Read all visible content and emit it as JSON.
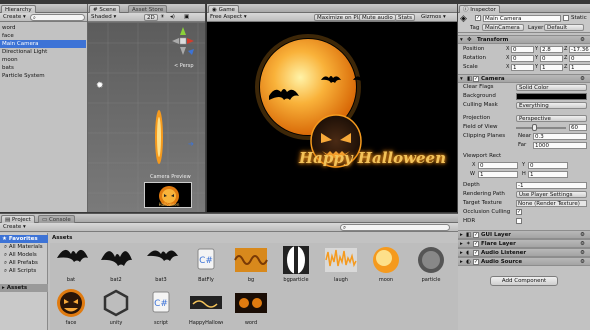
{
  "hierarchy": {
    "tab": "Hierarchy",
    "create": "Create",
    "search_icon": "search-icon",
    "items": [
      "word",
      "face",
      "Main Camera",
      "Directional Light",
      "moon",
      "bats",
      "Particle System"
    ],
    "selected_index": 2
  },
  "scene": {
    "tab": "Scene",
    "mode": "Shaded",
    "toggle_2d": "2D",
    "gizmo_label": "< Persp",
    "camera_preview": "Camera Preview"
  },
  "asset_store": {
    "tab": "Asset Store"
  },
  "game": {
    "tab": "Game",
    "aspect": "Free Aspect",
    "maximize": "Maximize on Play",
    "mute": "Mute audio",
    "stats": "Stats",
    "gizmos": "Gizmos",
    "title": "Happy Halloween"
  },
  "inspector": {
    "tab": "Inspector",
    "object_name": "Main Camera",
    "static": "Static",
    "tag_label": "Tag",
    "tag_value": "MainCamera",
    "layer_label": "Layer",
    "layer_value": "Default",
    "transform": {
      "title": "Transform",
      "rows": [
        {
          "label": "Position",
          "x": "0",
          "y": "2.8",
          "z": "-17.36"
        },
        {
          "label": "Rotation",
          "x": "0",
          "y": "0",
          "z": "0"
        },
        {
          "label": "Scale",
          "x": "1",
          "y": "1",
          "z": "1"
        }
      ]
    },
    "camera": {
      "title": "Camera",
      "clear_flags": {
        "label": "Clear Flags",
        "value": "Solid Color"
      },
      "background": {
        "label": "Background",
        "color": "#000000"
      },
      "culling_mask": {
        "label": "Culling Mask",
        "value": "Everything"
      },
      "projection": {
        "label": "Projection",
        "value": "Perspective"
      },
      "fov": {
        "label": "Field of View",
        "value": "60",
        "fraction": 0.33
      },
      "clipping": {
        "label": "Clipping Planes",
        "near_label": "Near",
        "near": "0.3",
        "far_label": "Far",
        "far": "1000"
      },
      "viewport": {
        "label": "Viewport Rect",
        "x": "0",
        "y": "0",
        "w": "1",
        "h": "1"
      },
      "depth": {
        "label": "Depth",
        "value": "-1"
      },
      "rendering_path": {
        "label": "Rendering Path",
        "value": "Use Player Settings"
      },
      "target_texture": {
        "label": "Target Texture",
        "value": "None (Render Texture)"
      },
      "occlusion": {
        "label": "Occlusion Culling",
        "checked": true
      },
      "hdr": {
        "label": "HDR",
        "checked": false
      }
    },
    "components": [
      "GUI Layer",
      "Flare Layer",
      "Audio Listener",
      "Audio Source"
    ],
    "add_component": "Add Component"
  },
  "project": {
    "tab": "Project",
    "console_tab": "Console",
    "create": "Create",
    "favorites": "Favorites",
    "favorite_items": [
      "All Materials",
      "All Models",
      "All Prefabs",
      "All Scripts"
    ],
    "assets_folder": "Assets",
    "breadcrumb": "Assets",
    "assets_row1": [
      "bat",
      "bat2",
      "bat3",
      "BatFly",
      "bg",
      "bgparticle",
      "laugh",
      "moon",
      "particle"
    ],
    "assets_row2": [
      "face",
      "unity",
      "script",
      "HappyHalloween",
      "word"
    ]
  },
  "colors": {
    "selection": "#3d73d6",
    "moon_orange": "#f59a1e",
    "text_glow": "#f3c35a"
  }
}
